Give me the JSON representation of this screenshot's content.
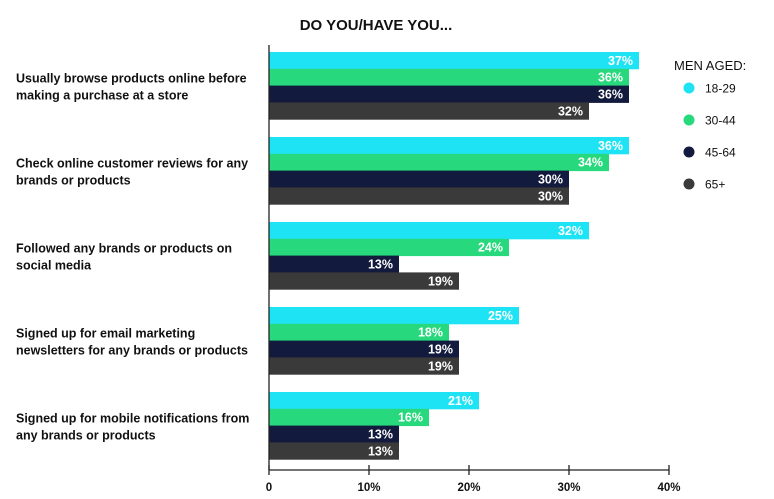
{
  "chart_data": {
    "type": "bar",
    "orientation": "horizontal",
    "title": "DO YOU/HAVE YOU...",
    "categories": [
      "Usually browse products online before making a purchase at a store",
      "Check online customer reviews for any brands or products",
      "Followed any brands or products on social media",
      "Signed up for email marketing newsletters for any brands or products",
      "Signed up for mobile notifications from any brands or products"
    ],
    "category_lines": [
      [
        "Usually browse products online before",
        "making a purchase at a store"
      ],
      [
        "Check online customer reviews for any",
        "brands or products"
      ],
      [
        "Followed any brands or products on",
        "social media"
      ],
      [
        "Signed up for email marketing",
        "newsletters for any brands or products"
      ],
      [
        "Signed up for mobile notifications from",
        "any brands or products"
      ]
    ],
    "series": [
      {
        "name": "18-29",
        "color": "#1ee3f5",
        "label_color": "#ffffff",
        "values": [
          37,
          36,
          32,
          25,
          21
        ],
        "labels": [
          "37%",
          "36%",
          "32%",
          "25%",
          "21%"
        ]
      },
      {
        "name": "30-44",
        "color": "#27d97c",
        "label_color": "#ffffff",
        "values": [
          36,
          34,
          24,
          18,
          16
        ],
        "labels": [
          "36%",
          "34%",
          "24%",
          "18%",
          "16%"
        ]
      },
      {
        "name": "45-64",
        "color": "#121a3d",
        "label_color": "#ffffff",
        "values": [
          36,
          30,
          13,
          19,
          13
        ],
        "labels": [
          "36%",
          "30%",
          "13%",
          "19%",
          "13%"
        ]
      },
      {
        "name": "65+",
        "color": "#3a3a3a",
        "label_color": "#ffffff",
        "values": [
          32,
          30,
          19,
          19,
          13
        ],
        "labels": [
          "32%",
          "30%",
          "19%",
          "19%",
          "13%"
        ]
      }
    ],
    "xlim": [
      0,
      40
    ],
    "xticks": [
      0,
      10,
      20,
      30,
      40
    ],
    "xtick_labels": [
      "0",
      "10%",
      "20%",
      "30%",
      "40%"
    ],
    "legend": {
      "title": "MEN AGED:",
      "position": "right"
    },
    "grid": false
  }
}
